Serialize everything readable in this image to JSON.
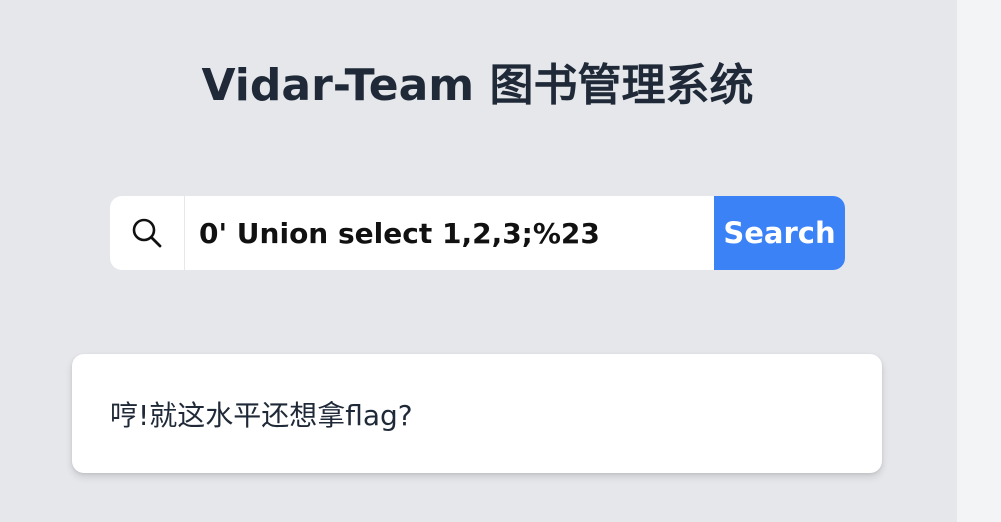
{
  "header": {
    "title": "Vidar-Team 图书管理系统"
  },
  "search": {
    "icon": "search-icon",
    "value": "0' Union select 1,2,3;%23",
    "button_label": "Search"
  },
  "result": {
    "message": "哼!就这水平还想拿flag?"
  },
  "colors": {
    "background": "#e5e7eb",
    "side_strip": "#f3f4f6",
    "title": "#1f2937",
    "accent": "#3b82f6",
    "card": "#ffffff"
  }
}
